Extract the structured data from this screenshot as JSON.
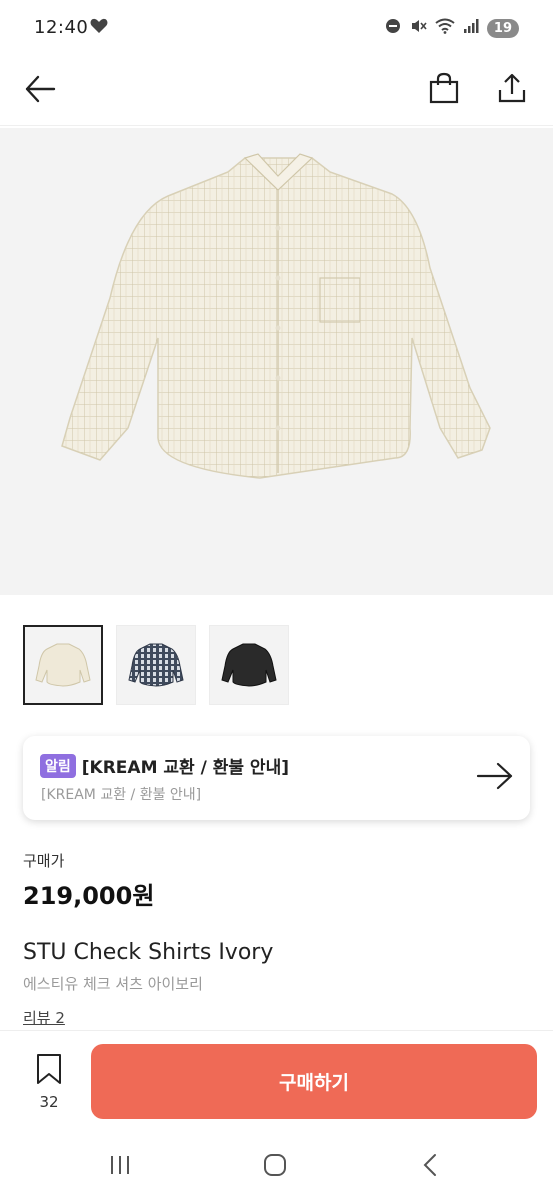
{
  "status_bar": {
    "time": "12:40",
    "battery": "19"
  },
  "header": {
    "back_icon": "arrow-left-icon",
    "bag_icon": "shopping-bag-icon",
    "share_icon": "share-icon"
  },
  "gallery": {
    "thumbnails": [
      "ivory",
      "navy-check",
      "black"
    ]
  },
  "notice": {
    "badge": "알림",
    "title": "[KREAM 교환 / 환불 안내]",
    "subtitle": "[KREAM 교환 / 환불 안내]"
  },
  "price": {
    "label": "구매가",
    "value": "219,000원"
  },
  "product": {
    "name": "STU Check Shirts Ivory",
    "name_ko": "에스티유 체크 셔츠 아이보리",
    "review": "리뷰 2"
  },
  "bottom": {
    "wish_count": "32",
    "buy_label": "구매하기"
  },
  "colors": {
    "accent": "#ef6a56",
    "badge": "#8f6fe0"
  }
}
